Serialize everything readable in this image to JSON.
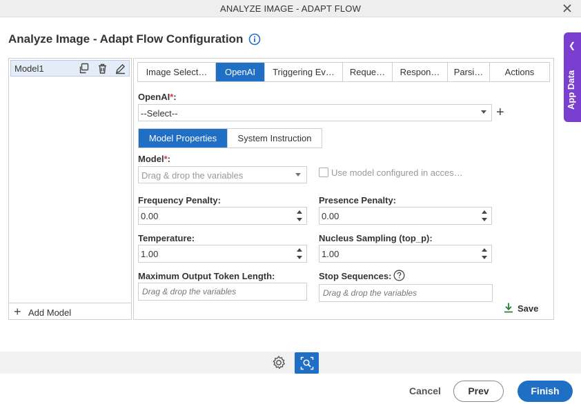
{
  "window": {
    "title": "ANALYZE IMAGE - ADAPT FLOW"
  },
  "heading": "Analyze Image - Adapt Flow Configuration",
  "app_data_label": "App Data",
  "models": {
    "items": [
      {
        "name": "Model1"
      }
    ],
    "add_label": "Add Model"
  },
  "tabs": [
    {
      "label": "Image Select…",
      "active": false
    },
    {
      "label": "OpenAI",
      "active": true
    },
    {
      "label": "Triggering Ev…",
      "active": false
    },
    {
      "label": "Reque…",
      "active": false
    },
    {
      "label": "Respon…",
      "active": false
    },
    {
      "label": "Parsi…",
      "active": false
    },
    {
      "label": "Actions",
      "active": false
    }
  ],
  "openai": {
    "label": "OpenAI",
    "required_mark": "*",
    "colon": ":",
    "value": "--Select--"
  },
  "subtabs": {
    "model_properties": "Model Properties",
    "system_instruction": "System Instruction"
  },
  "model": {
    "label": "Model",
    "required_mark": "*",
    "colon": ":",
    "placeholder": "Drag & drop the variables"
  },
  "use_model_checkbox": {
    "label": "Use model configured in acces…",
    "checked": false
  },
  "frequency_penalty": {
    "label": "Frequency Penalty:",
    "value": "0.00"
  },
  "presence_penalty": {
    "label": "Presence Penalty:",
    "value": "0.00"
  },
  "temperature": {
    "label": "Temperature:",
    "value": "1.00"
  },
  "nucleus_sampling": {
    "label": "Nucleus Sampling (top_p):",
    "value": "1.00"
  },
  "max_tokens": {
    "label": "Maximum Output Token Length:",
    "placeholder": "Drag & drop the variables"
  },
  "stop_sequences": {
    "label": "Stop Sequences:",
    "placeholder": "Drag & drop the variables"
  },
  "save_label": "Save",
  "footer": {
    "cancel": "Cancel",
    "prev": "Prev",
    "finish": "Finish"
  },
  "colors": {
    "accent": "#1f6fc5",
    "app_data": "#7a3fd1",
    "save_icon": "#2e7d32"
  }
}
